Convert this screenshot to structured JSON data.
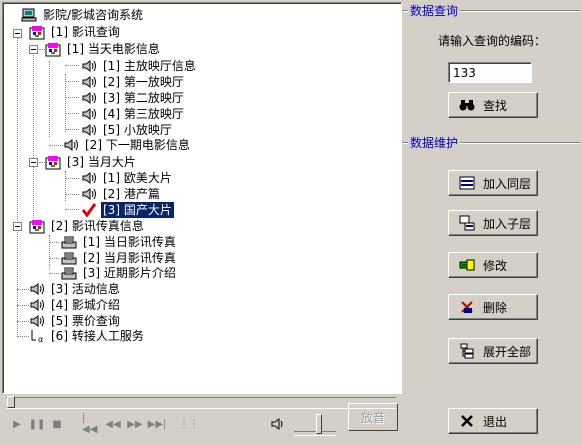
{
  "tree": {
    "nodes": [
      {
        "id": "root",
        "label": "影院/影城咨询系统",
        "icon": "computer-icon"
      },
      {
        "id": "n1",
        "label": "[1] 影讯查询",
        "icon": "film-folder-icon"
      },
      {
        "id": "n1_1",
        "label": "[1] 当天电影信息",
        "icon": "film-folder-icon"
      },
      {
        "id": "n1_1_1",
        "label": "[1] 主放映厅信息",
        "icon": "speaker-icon"
      },
      {
        "id": "n1_1_2",
        "label": "[2] 第一放映厅",
        "icon": "speaker-icon"
      },
      {
        "id": "n1_1_3",
        "label": "[3] 第二放映厅",
        "icon": "speaker-icon"
      },
      {
        "id": "n1_1_4",
        "label": "[4] 第三放映厅",
        "icon": "speaker-icon"
      },
      {
        "id": "n1_1_5",
        "label": "[5] 小放映厅",
        "icon": "speaker-icon"
      },
      {
        "id": "n1_2",
        "label": "[2] 下一期电影信息",
        "icon": "speaker-icon"
      },
      {
        "id": "n1_3",
        "label": "[3] 当月大片",
        "icon": "film-folder-icon"
      },
      {
        "id": "n1_3_1",
        "label": "[1] 欧美大片",
        "icon": "speaker-icon"
      },
      {
        "id": "n1_3_2",
        "label": "[2] 港产篇",
        "icon": "speaker-icon"
      },
      {
        "id": "n1_3_3",
        "label": "[3] 国产大片",
        "icon": "checkmark-icon",
        "selected": true
      },
      {
        "id": "n2",
        "label": "[2] 影讯传真信息",
        "icon": "film-folder-icon"
      },
      {
        "id": "n2_1",
        "label": "[1] 当日影讯传真",
        "icon": "fax-icon"
      },
      {
        "id": "n2_2",
        "label": "[2] 当月影讯传真",
        "icon": "fax-icon"
      },
      {
        "id": "n2_3",
        "label": "[3] 近期影片介绍",
        "icon": "fax-icon"
      },
      {
        "id": "n3",
        "label": "[3] 活动信息",
        "icon": "speaker-icon"
      },
      {
        "id": "n4",
        "label": "[4] 影城介绍",
        "icon": "speaker-icon"
      },
      {
        "id": "n5",
        "label": "[5] 票价查询",
        "icon": "speaker-icon"
      },
      {
        "id": "n6",
        "label": "[6] 转接人工服务",
        "icon": "transfer-icon"
      }
    ]
  },
  "media": {
    "play_label": "放音",
    "controls": [
      "play-icon",
      "pause-icon",
      "stop-icon",
      "skip-back-icon",
      "rewind-icon",
      "forward-icon",
      "skip-forward-icon",
      "playlist-icon",
      "volume-icon"
    ]
  },
  "query": {
    "title": "数据查询",
    "prompt": "请输入查询的编码：",
    "code_value": "133",
    "find_label": "查找"
  },
  "maintenance": {
    "title": "数据维护",
    "add_sibling_label": "加入同层",
    "add_child_label": "加入子层",
    "edit_label": "修改",
    "delete_label": "删除",
    "expand_all_label": "展开全部"
  },
  "exit_label": "退出",
  "colors": {
    "selection": "#0a246a",
    "group_title": "#0000c0",
    "face": "#d4d0c8"
  }
}
